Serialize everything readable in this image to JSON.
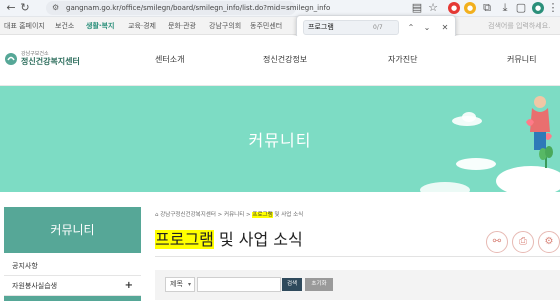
{
  "browser": {
    "url": "gangnam.go.kr/office/smilegn/board/smilegn_info/list.do?mid=smilegn_info",
    "find": {
      "query": "프로그램",
      "count": "0/7"
    }
  },
  "gnb": {
    "items": [
      "대표 홈페이지",
      "보건소",
      "생활·복지",
      "교육·경제",
      "문화·관광",
      "강남구의회",
      "동주민센터"
    ],
    "search_placeholder": "검색어를 입력하세요."
  },
  "header": {
    "logo_small": "강남구보건소",
    "logo_name": "정신건강복지센터",
    "menu": [
      "센터소개",
      "정신건강정보",
      "자가진단",
      "커뮤니티"
    ]
  },
  "banner": {
    "title": "커뮤니티"
  },
  "sidebar": {
    "title": "커뮤니티",
    "items": [
      {
        "label": "공지사항",
        "has_plus": false
      },
      {
        "label": "자원봉사실습생",
        "has_plus": true
      }
    ]
  },
  "breadcrumb": {
    "home": "강남구정신건강복지센터",
    "section": "커뮤니티",
    "current_hl": "프로그램",
    "current_rest": " 및 사업 소식"
  },
  "page": {
    "title_hl": "프로그램",
    "title_rest": " 및 사업 소식"
  },
  "search": {
    "select_value": "제목",
    "search_label": "검색",
    "reset_label": "초기화"
  },
  "colors": {
    "brand_teal": "#56a797",
    "banner_mint": "#7ddcc4",
    "highlight": "#ffff00"
  }
}
